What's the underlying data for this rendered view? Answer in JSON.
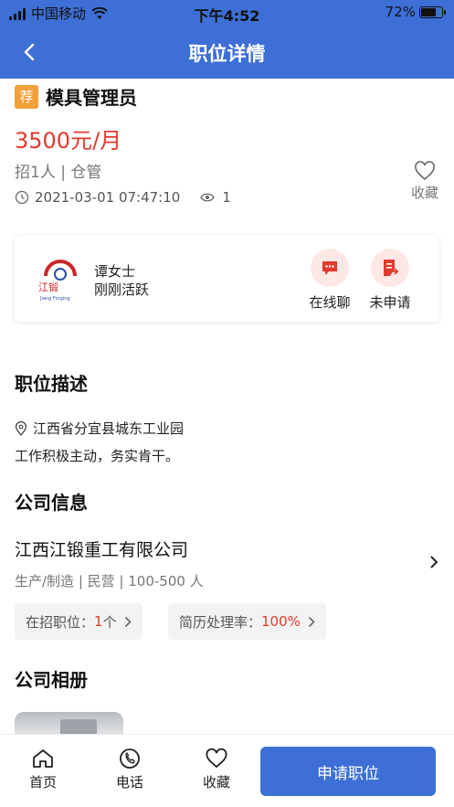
{
  "status_bar": {
    "carrier": "中国移动",
    "time": "下午4:52",
    "battery_percent": "72%",
    "battery_level": 0.72
  },
  "nav": {
    "title": "职位详情"
  },
  "job": {
    "tag": "荐",
    "title": "模具管理员",
    "salary": "3500元/月",
    "meta": "招1人 | 仓管",
    "posted_at": "2021-03-01 07:47:10",
    "views": "1",
    "favorite_label": "收藏"
  },
  "recruiter": {
    "logo_text": "江锻",
    "logo_sub": "Jiang Forging",
    "name": "谭女士",
    "status": "刚刚活跃",
    "chat_label": "在线聊",
    "apply_status_label": "未申请"
  },
  "description": {
    "section_title": "职位描述",
    "location": "江西省分宜县城东工业园",
    "text": "工作积极主动，务实肯干。"
  },
  "company": {
    "section_title": "公司信息",
    "name": "江西江锻重工有限公司",
    "tags": "生产/制造 | 民营 | 100-500 人",
    "open_positions_label": "在招职位：",
    "open_positions_value": "1",
    "open_positions_unit": "个",
    "resume_rate_label": "简历处理率：",
    "resume_rate_value": "100%"
  },
  "album": {
    "section_title": "公司相册"
  },
  "bottom_bar": {
    "home_label": "首页",
    "phone_label": "电话",
    "favorite_label": "收藏",
    "apply_label": "申请职位"
  },
  "colors": {
    "primary": "#3d6fd6",
    "salary_red": "#e23a2e",
    "tag_orange": "#f2a03a"
  }
}
